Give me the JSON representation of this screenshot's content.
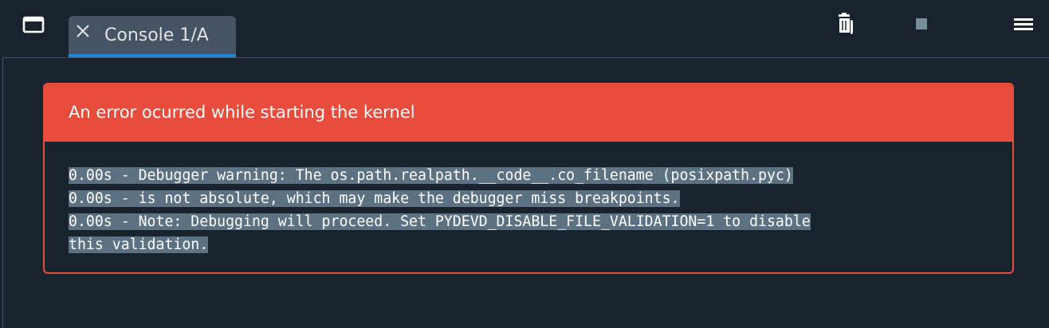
{
  "tab": {
    "label": "Console 1/A"
  },
  "error": {
    "title": "An error ocurred while starting the kernel",
    "lines": [
      "0.00s - Debugger warning: The os.path.realpath.__code__.co_filename (posixpath.pyc)",
      "0.00s - is not absolute, which may make the debugger miss breakpoints.",
      "0.00s - Note: Debugging will proceed. Set PYDEVD_DISABLE_FILE_VALIDATION=1 to disable",
      "this validation."
    ]
  },
  "icons": {
    "window": "window-icon",
    "close": "close-icon",
    "trash": "trash-icon",
    "stop": "stop-icon",
    "menu": "hamburger-menu-icon"
  },
  "colors": {
    "background": "#19232d",
    "tab_background": "#455364",
    "tab_accent": "#1e88d9",
    "error_red": "#e74c3c",
    "selection": "#5c7182",
    "text": "#ffffff",
    "muted_icon": "#788d9c"
  }
}
